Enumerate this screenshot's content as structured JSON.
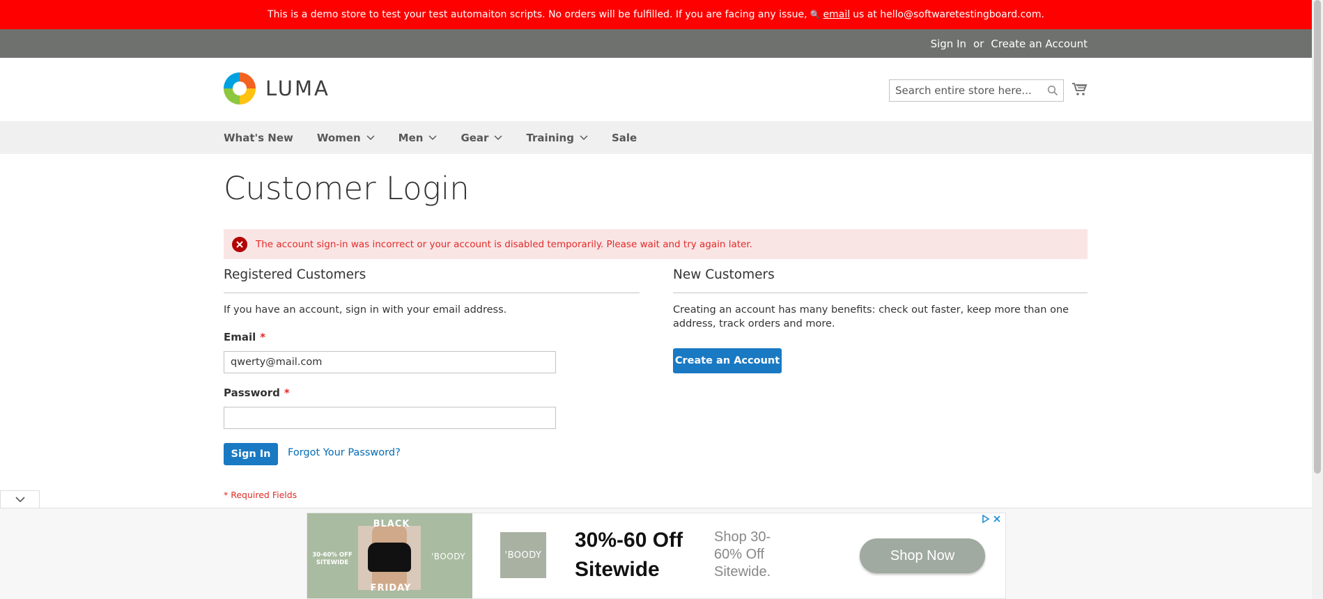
{
  "demo_notice": {
    "text": "This is a demo store to test your test automaiton scripts. No orders will be fulfilled. If you are facing any issue,",
    "key_glyph": "🔍",
    "link": "email",
    "after": "us at hello@softwaretestingboard.com."
  },
  "header": {
    "sign_in": "Sign In",
    "or": "or",
    "create_account": "Create an Account"
  },
  "logo": {
    "text": "LUMA"
  },
  "search": {
    "placeholder": "Search entire store here..."
  },
  "nav": {
    "items": [
      {
        "label": "What's New"
      },
      {
        "label": "Women"
      },
      {
        "label": "Men"
      },
      {
        "label": "Gear"
      },
      {
        "label": "Training"
      },
      {
        "label": "Sale"
      }
    ]
  },
  "page": {
    "title": "Customer Login"
  },
  "error": {
    "message": "The account sign-in was incorrect or your account is disabled temporarily. Please wait and try again later."
  },
  "registered": {
    "title": "Registered Customers",
    "intro": "If you have an account, sign in with your email address.",
    "email_label": "Email",
    "email_value": "qwerty@mail.com",
    "password_label": "Password",
    "password_value": "",
    "required_mark": "*",
    "sign_in": "Sign In",
    "forgot": "Forgot Your Password?",
    "required_note": "* Required Fields"
  },
  "new_customers": {
    "title": "New Customers",
    "intro": "Creating an account has many benefits: check out faster, keep more than one address, track orders and more.",
    "create": "Create an Account"
  },
  "ad": {
    "black": "BLACK",
    "friday": "FRIDAY",
    "off_small": "30-60% OFF SITEWIDE",
    "brand_small": "'BOODY",
    "brand_logo": "'BOODY",
    "headline": "30%-60 Off Sitewide",
    "sub": "Shop 30-60% Off Sitewide.",
    "cta": "Shop Now"
  },
  "colors": {
    "demo_bar": "#ff0000",
    "header_bar": "#6e716e",
    "primary": "#1979c3",
    "error_bg": "#fae5e5",
    "error_text": "#e02b27"
  }
}
